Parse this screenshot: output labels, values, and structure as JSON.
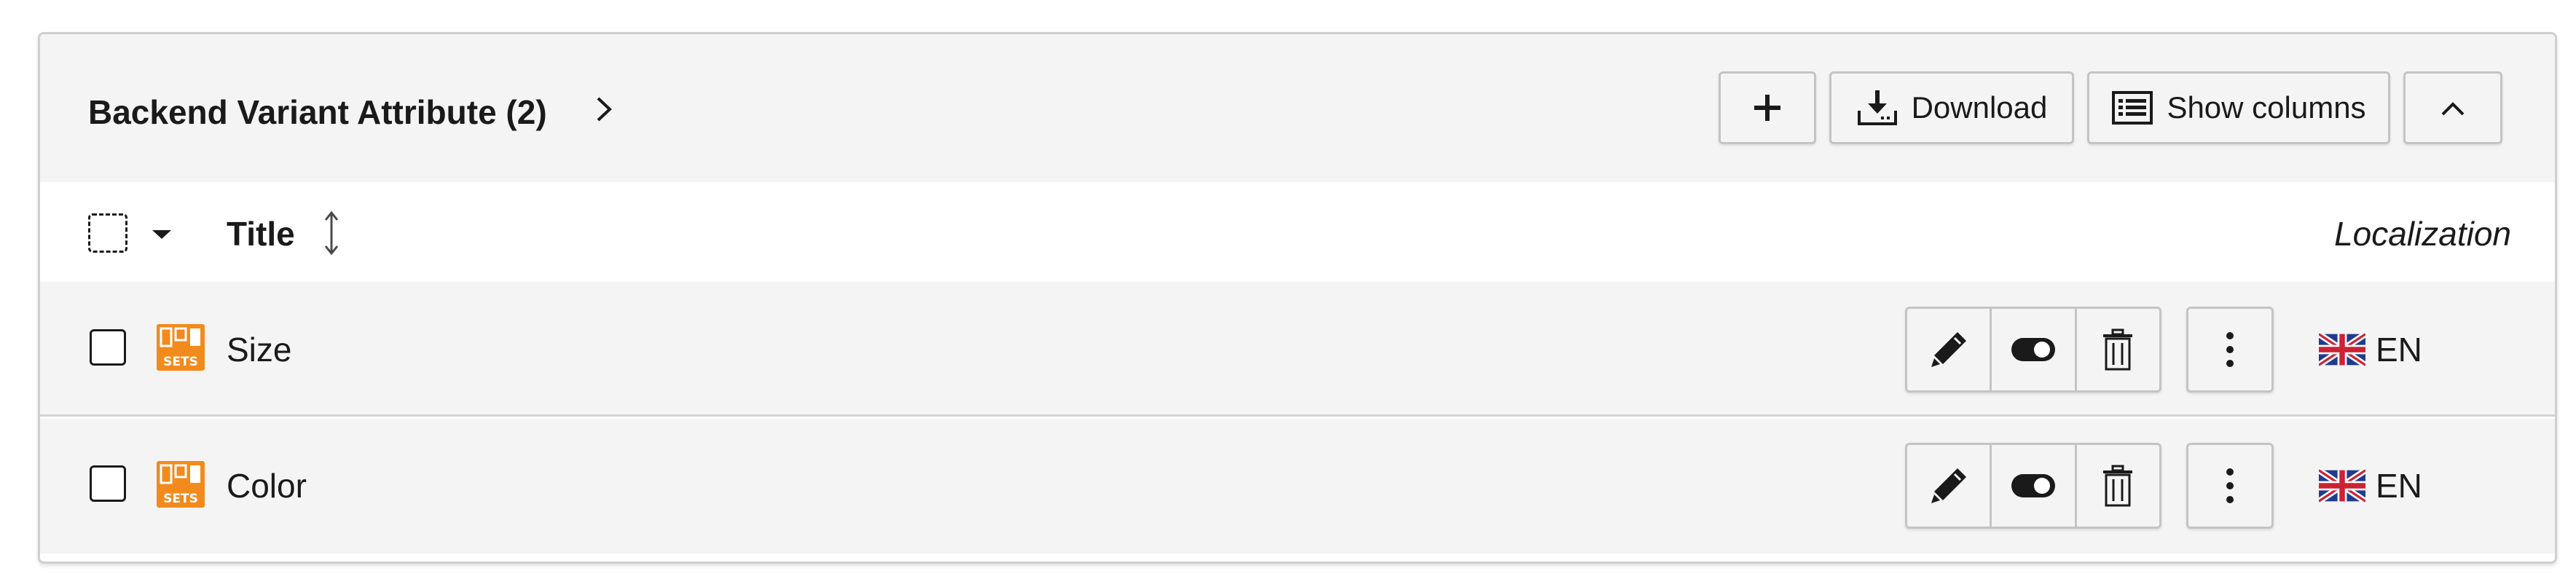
{
  "header": {
    "title": "Backend Variant Attribute (2)",
    "download_label": "Download",
    "show_columns_label": "Show columns"
  },
  "columns": {
    "title": "Title",
    "localization": "Localization"
  },
  "rows": [
    {
      "title": "Size",
      "language": "EN",
      "icon": "sets-record-icon"
    },
    {
      "title": "Color",
      "language": "EN",
      "icon": "sets-record-icon"
    }
  ],
  "colors": {
    "accent_icon": "#f28a1c",
    "header_bg": "#f4f4f4",
    "border": "#d4d4d4"
  }
}
